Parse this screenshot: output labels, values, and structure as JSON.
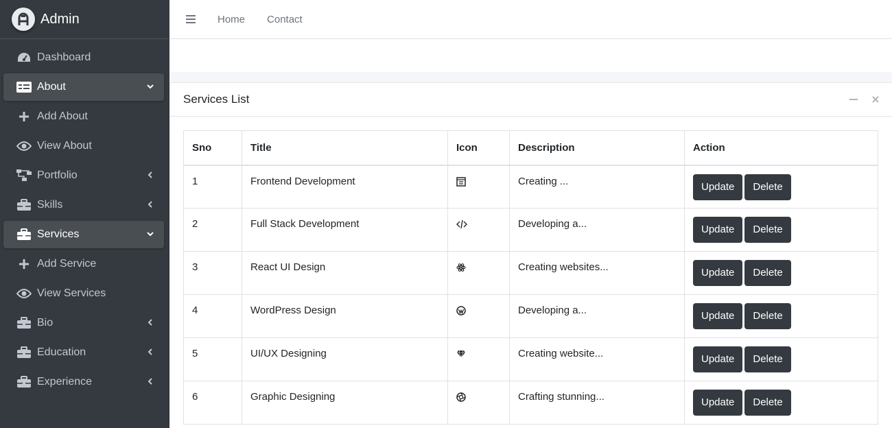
{
  "brand": {
    "name": "Admin"
  },
  "sidebar": {
    "items": [
      {
        "label": "Dashboard"
      },
      {
        "label": "About"
      },
      {
        "label": "Add About"
      },
      {
        "label": "View About"
      },
      {
        "label": "Portfolio"
      },
      {
        "label": "Skills"
      },
      {
        "label": "Services"
      },
      {
        "label": "Add Service"
      },
      {
        "label": "View Services"
      },
      {
        "label": "Bio"
      },
      {
        "label": "Education"
      },
      {
        "label": "Experience"
      }
    ]
  },
  "topbar": {
    "links": [
      "Home",
      "Contact"
    ]
  },
  "card": {
    "title": "Services List"
  },
  "table": {
    "headers": [
      "Sno",
      "Title",
      "Icon",
      "Description",
      "Action"
    ],
    "rows": [
      {
        "sno": "1",
        "title": "Frontend Development",
        "icon": "browser-window-icon",
        "description": "Creating ..."
      },
      {
        "sno": "2",
        "title": "Full Stack Development",
        "icon": "code-icon",
        "description": "Developing a..."
      },
      {
        "sno": "3",
        "title": "React UI Design",
        "icon": "react-atom-icon",
        "description": "Creating websites..."
      },
      {
        "sno": "4",
        "title": "WordPress Design",
        "icon": "wordpress-icon",
        "description": "Developing a..."
      },
      {
        "sno": "5",
        "title": "UI/UX Designing",
        "icon": "gem-icon",
        "description": "Creating website..."
      },
      {
        "sno": "6",
        "title": "Graphic Designing",
        "icon": "aperture-icon",
        "description": "Crafting stunning..."
      }
    ],
    "update_label": "Update",
    "delete_label": "Delete"
  },
  "colors": {
    "sidebar_bg": "#343a40",
    "sidebar_active": "#494e53",
    "button_bg": "#343a40"
  }
}
